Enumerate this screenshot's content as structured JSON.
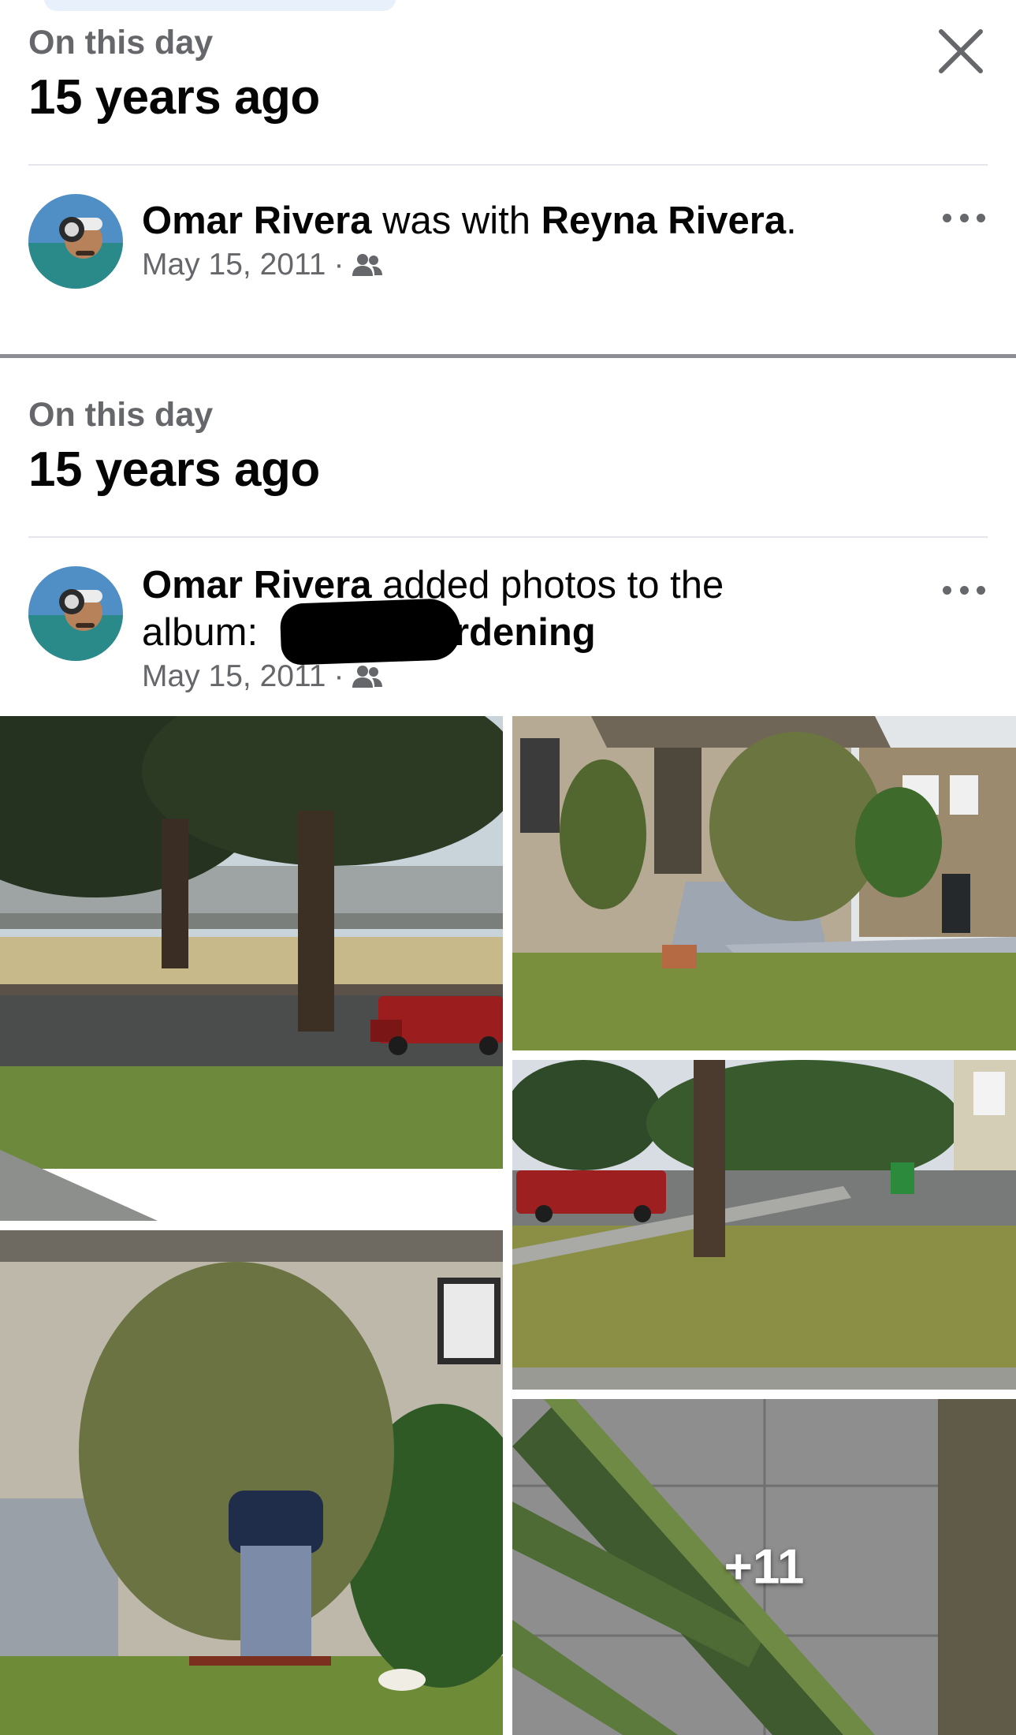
{
  "memory1": {
    "label": "On this day",
    "title": "15 years ago",
    "post": {
      "author": "Omar Rivera",
      "action": " was with ",
      "tagged": "Reyna Rivera",
      "end": ".",
      "date": "May 15, 2011",
      "audience_icon": "friends-icon"
    }
  },
  "memory2": {
    "label": "On this day",
    "title": "15 years ago",
    "post": {
      "author": "Omar Rivera",
      "action": " added photos to the",
      "action2": "album: ",
      "album_visible": "Gardening",
      "date": "May 15, 2011",
      "audience_icon": "friends-icon"
    },
    "photos": {
      "more_count": "+11"
    }
  },
  "icons": {
    "close": "close-icon",
    "more": "more-options-icon"
  },
  "colors": {
    "text_primary": "#050505",
    "text_secondary": "#65676b",
    "divider": "#e4e6eb"
  }
}
